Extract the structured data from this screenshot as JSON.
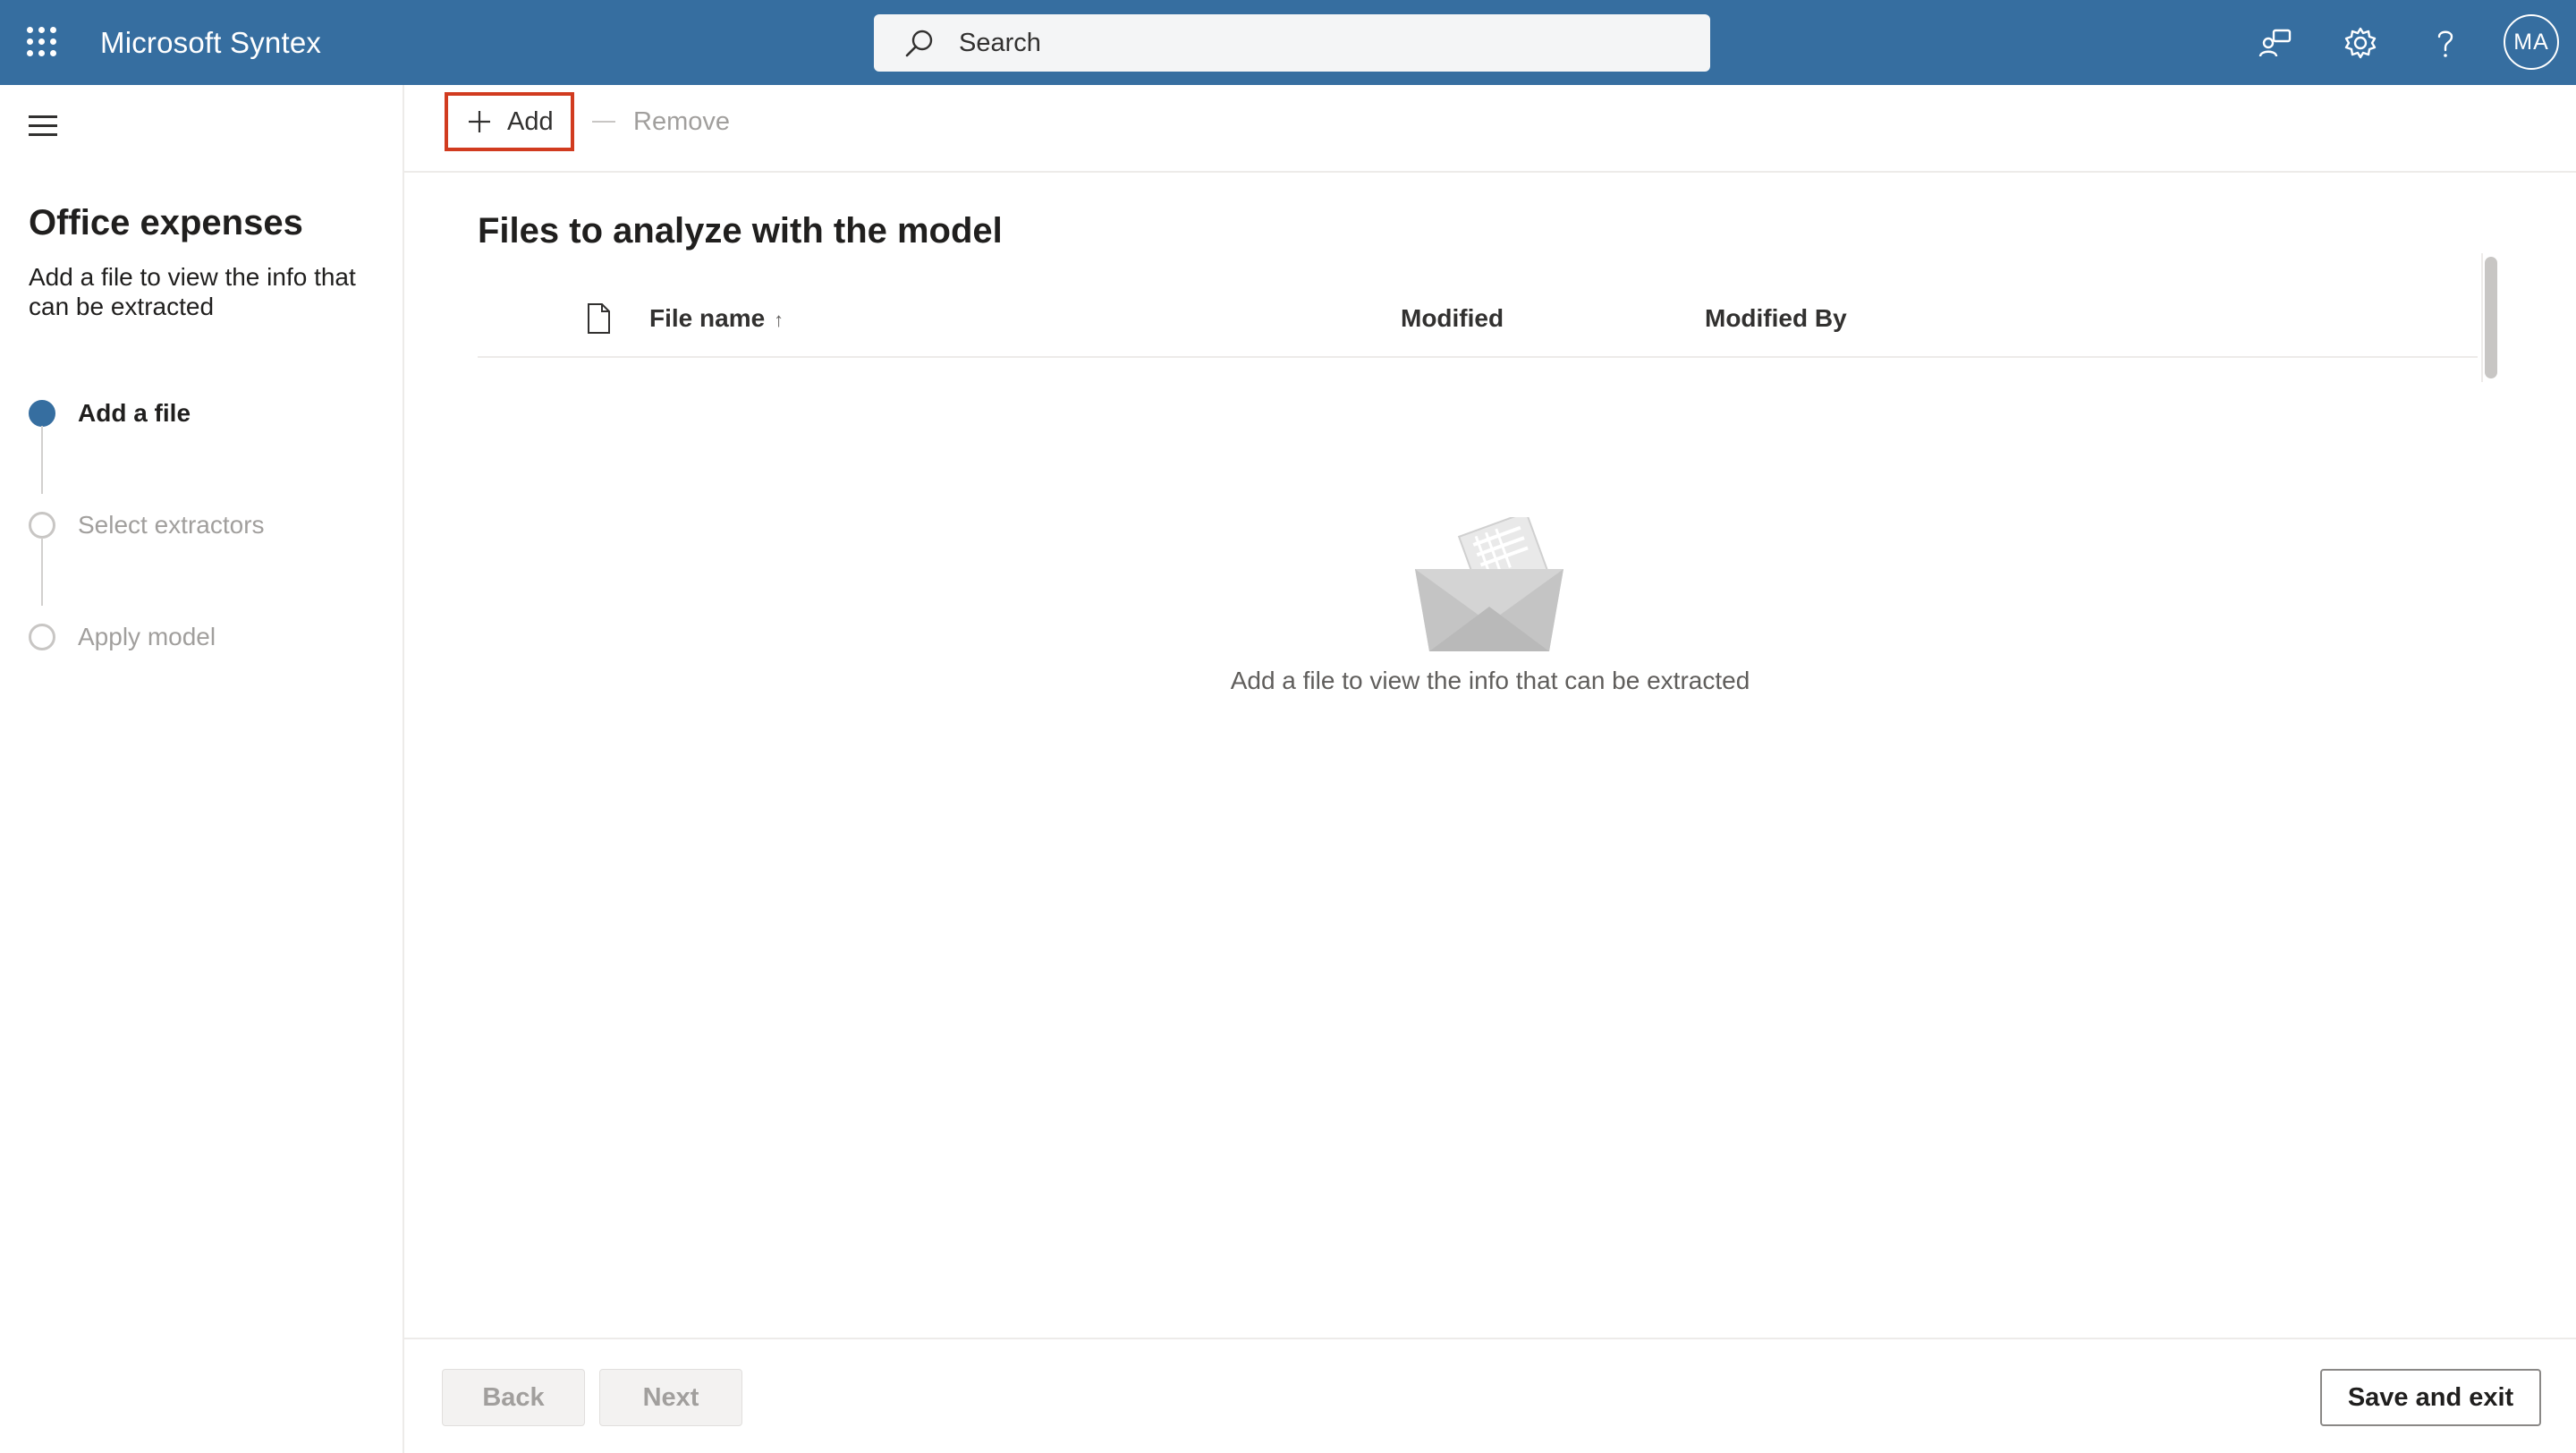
{
  "header": {
    "app_title": "Microsoft Syntex",
    "search_placeholder": "Search",
    "avatar_initials": "MA",
    "icons": [
      "waffle-icon",
      "search-icon",
      "feedback-icon",
      "gear-icon",
      "help-icon"
    ]
  },
  "sidebar": {
    "title": "Office expenses",
    "subtitle": "Add a file to view the info that can be extracted",
    "steps": [
      {
        "label": "Add a file",
        "state": "active"
      },
      {
        "label": "Select extractors",
        "state": "inactive"
      },
      {
        "label": "Apply model",
        "state": "inactive"
      }
    ]
  },
  "commandbar": {
    "add_label": "Add",
    "remove_label": "Remove"
  },
  "main": {
    "title": "Files to analyze with the model",
    "columns": {
      "file_name": "File name",
      "sort_indicator": "↑",
      "modified": "Modified",
      "modified_by": "Modified By"
    },
    "empty_message": "Add a file to view the info that can be extracted"
  },
  "footer": {
    "back_label": "Back",
    "next_label": "Next",
    "save_exit_label": "Save and exit"
  },
  "colors": {
    "brand": "#366ea0",
    "highlight_border": "#d13b1f"
  }
}
